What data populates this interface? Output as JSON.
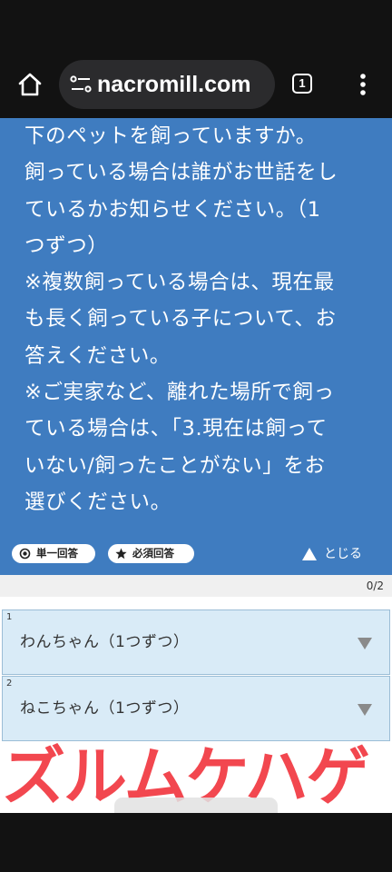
{
  "browser": {
    "url": "nacromill.com",
    "tab_count": "1",
    "icons": [
      "home-icon",
      "site-settings-icon",
      "tab-switcher-icon",
      "more-vert-icon"
    ]
  },
  "question": {
    "lines": [
      "下のペットを飼っていますか。",
      "飼っている場合は誰がお世話をし",
      "ているかお知らせください。（1",
      "つずつ）",
      "※複数飼っている場合は、現在最",
      "も長く飼っている子について、お",
      "答えください。",
      "※ご実家など、離れた場所で飼っ",
      "ている場合は、「3.現在は飼って",
      "いない/飼ったことがない」をお",
      "選びください。"
    ],
    "badge_single": "単一回答",
    "badge_required": "必須回答",
    "collapse_label": "とじる"
  },
  "progress": {
    "count": "0/2"
  },
  "items": [
    {
      "number": "1",
      "label": "わんちゃん（1つずつ）"
    },
    {
      "number": "2",
      "label": "ねこちゃん（1つずつ）"
    }
  ],
  "overlay": {
    "text": "ズルムケハゲ"
  },
  "colors": {
    "panel_blue": "#3f7cc0",
    "row_bg": "#d9ebf7",
    "overlay_red": "#f2474f"
  }
}
